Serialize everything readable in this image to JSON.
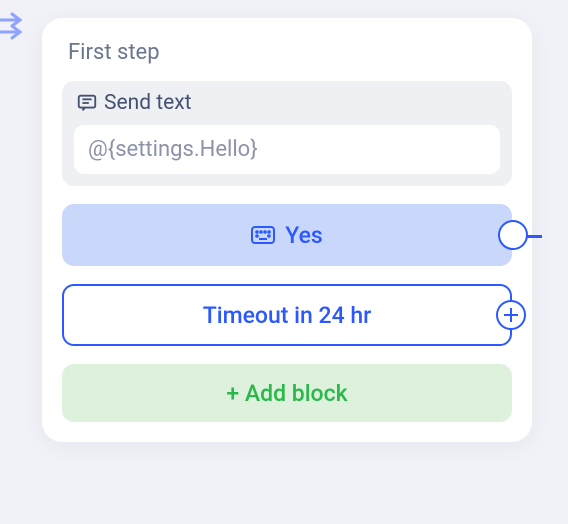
{
  "step": {
    "title": "First step",
    "send": {
      "label": "Send text",
      "value": "@{settings.Hello}"
    },
    "options": {
      "yes": "Yes",
      "timeout": "Timeout in 24 hr"
    },
    "add_block": "+ Add block"
  },
  "colors": {
    "accent": "#2b59ff",
    "yes_bg": "#c9d7fb",
    "add_bg": "#def1dc",
    "add_fg": "#2ab84a"
  }
}
